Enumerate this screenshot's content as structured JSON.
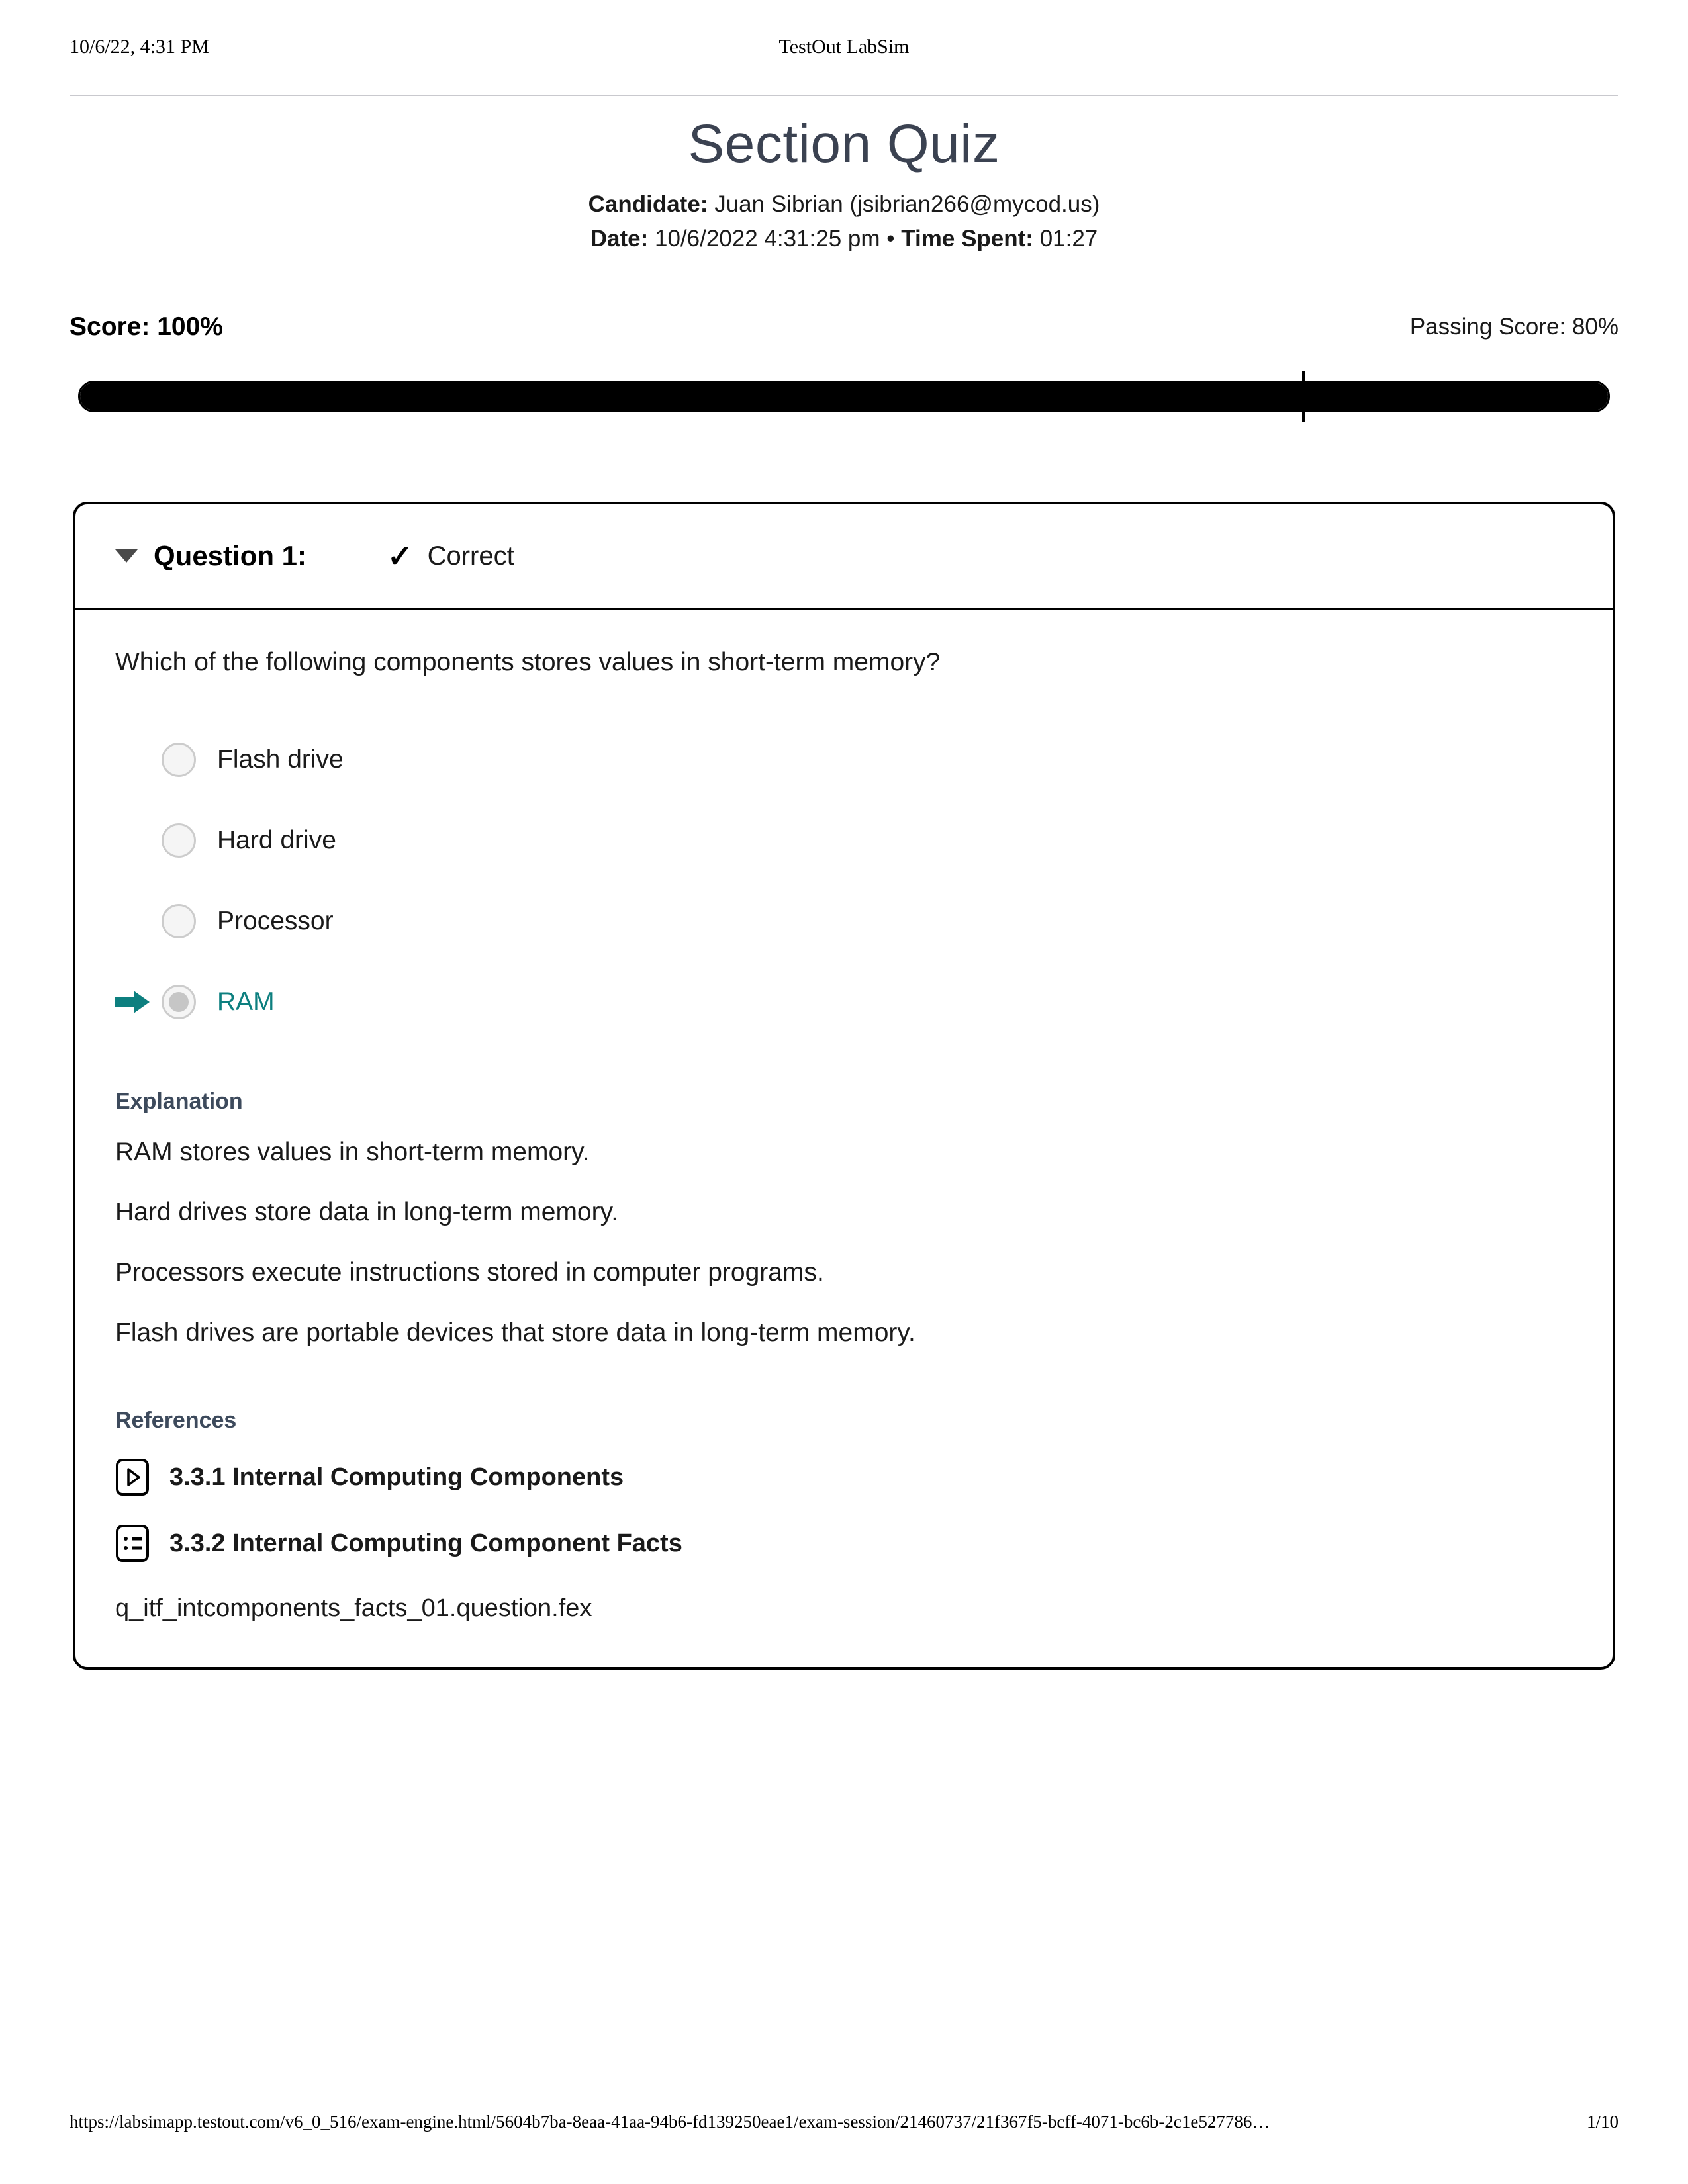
{
  "print_header": {
    "left": "10/6/22, 4:31 PM",
    "center": "TestOut LabSim"
  },
  "title": "Section Quiz",
  "meta": {
    "candidate_label": "Candidate:",
    "candidate_value": "Juan Sibrian  (jsibrian266@mycod.us)",
    "date_label": "Date:",
    "date_value": "10/6/2022 4:31:25 pm",
    "separator": "•",
    "time_spent_label": "Time Spent:",
    "time_spent_value": "01:27"
  },
  "score": {
    "score_text": "Score: 100%",
    "passing_text": "Passing Score: 80%",
    "score_percent": 100,
    "passing_percent": 80
  },
  "question": {
    "caret_icon": "caret-down-icon",
    "label": "Question 1:",
    "status_icon": "check-icon",
    "status": "Correct",
    "prompt": "Which of the following components stores values in short-term memory?",
    "options": [
      {
        "text": "Flash drive",
        "selected": false
      },
      {
        "text": "Hard drive",
        "selected": false
      },
      {
        "text": "Processor",
        "selected": false
      },
      {
        "text": "RAM",
        "selected": true
      }
    ],
    "explanation_heading": "Explanation",
    "explanation_lines": [
      "RAM stores values in short-term memory.",
      "Hard drives store data in long-term memory.",
      "Processors execute instructions stored in computer programs.",
      "Flash drives are portable devices that store data in long-term memory."
    ],
    "references_heading": "References",
    "references": [
      {
        "icon": "video-play-icon",
        "text": "3.3.1 Internal Computing Components"
      },
      {
        "icon": "list-facts-icon",
        "text": "3.3.2 Internal Computing Component Facts"
      }
    ],
    "file_name": "q_itf_intcomponents_facts_01.question.fex"
  },
  "print_footer": {
    "url": "https://labsimapp.testout.com/v6_0_516/exam-engine.html/5604b7ba-8eaa-41aa-94b6-fd139250eae1/exam-session/21460737/21f367f5-bcff-4071-bc6b-2c1e527786…",
    "page": "1/10"
  },
  "colors": {
    "accent_teal": "#0d7f7f",
    "heading_slate": "#3d4a5c",
    "title_slate": "#3b4251",
    "bar_fill": "#000000"
  }
}
